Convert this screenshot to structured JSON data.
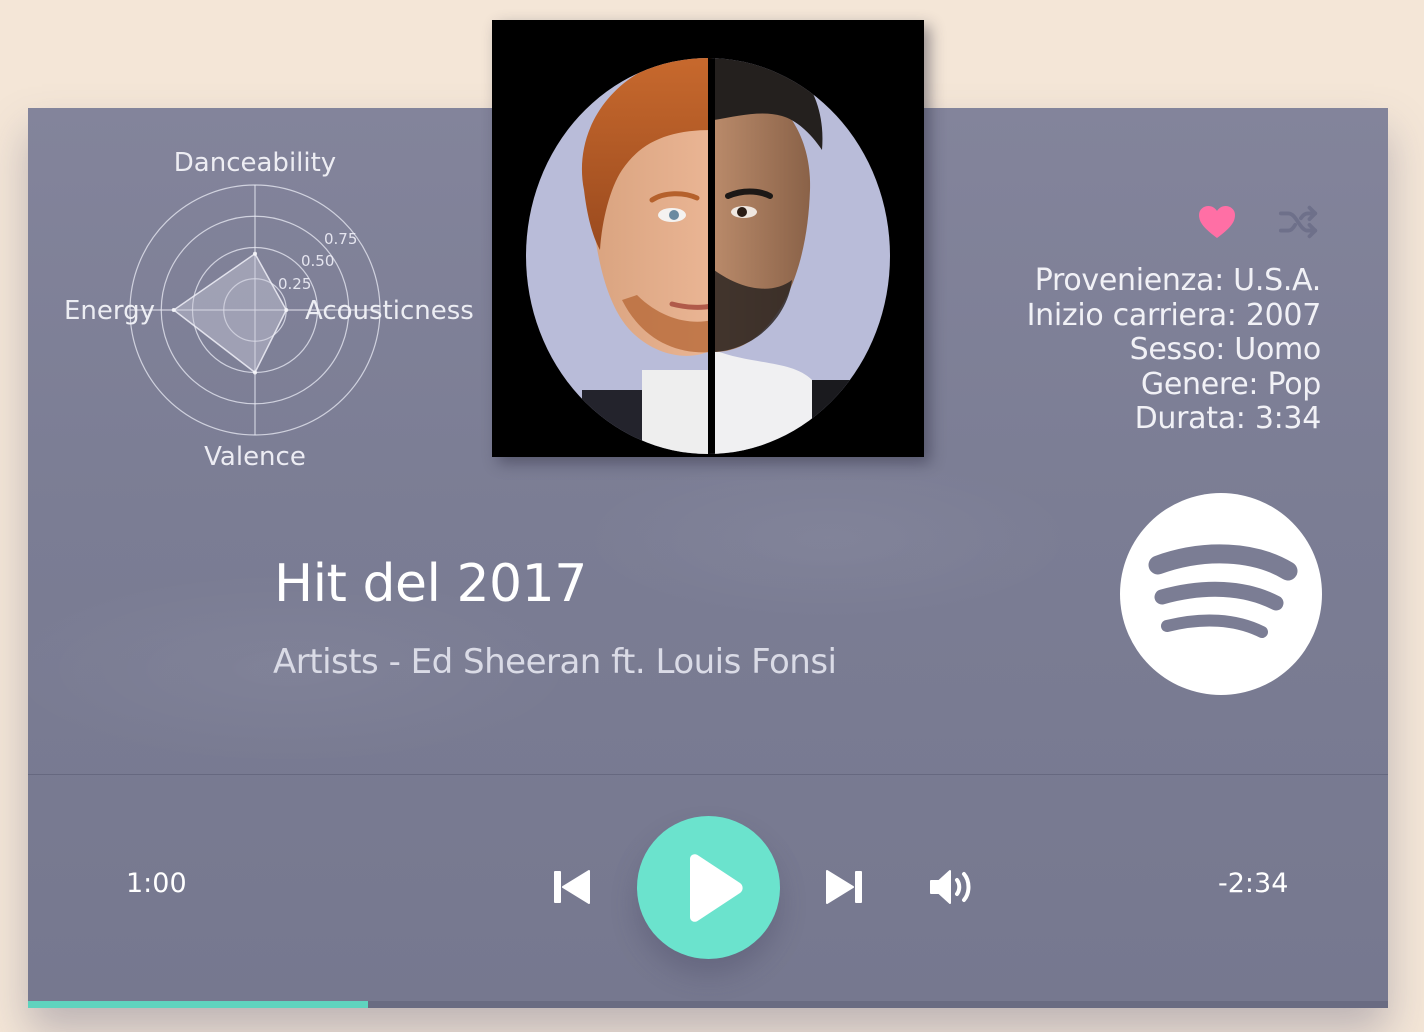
{
  "track": {
    "title": "Hit del 2017",
    "artists": "Artists - Ed Sheeran ft. Louis Fonsi"
  },
  "artist_info": {
    "origin": "Provenienza: U.S.A.",
    "career_start": "Inizio carriera: 2007",
    "gender": "Sesso: Uomo",
    "genre": "Genere: Pop",
    "duration": "Durata: 3:34"
  },
  "player": {
    "elapsed": "1:00",
    "remaining": "-2:34",
    "progress": 0.25
  },
  "icons": {
    "favorite": "heart-icon",
    "shuffle": "shuffle-icon",
    "previous": "skip-previous-icon",
    "play": "play-icon",
    "next": "skip-next-icon",
    "volume": "volume-icon",
    "service": "spotify-logo"
  },
  "colors": {
    "background": "#f4e6d7",
    "card": "#7d7f96",
    "accent": "#6be3cd",
    "heart": "#ff6fa5"
  },
  "chart_data": {
    "type": "radar",
    "axes": [
      "Danceability",
      "Acousticness",
      "Valence",
      "Energy"
    ],
    "values": [
      0.45,
      0.25,
      0.5,
      0.65
    ],
    "rings": [
      0.25,
      0.5,
      0.75,
      1.0
    ],
    "ring_labels": [
      "0.25",
      "0.50",
      "0.75"
    ]
  }
}
